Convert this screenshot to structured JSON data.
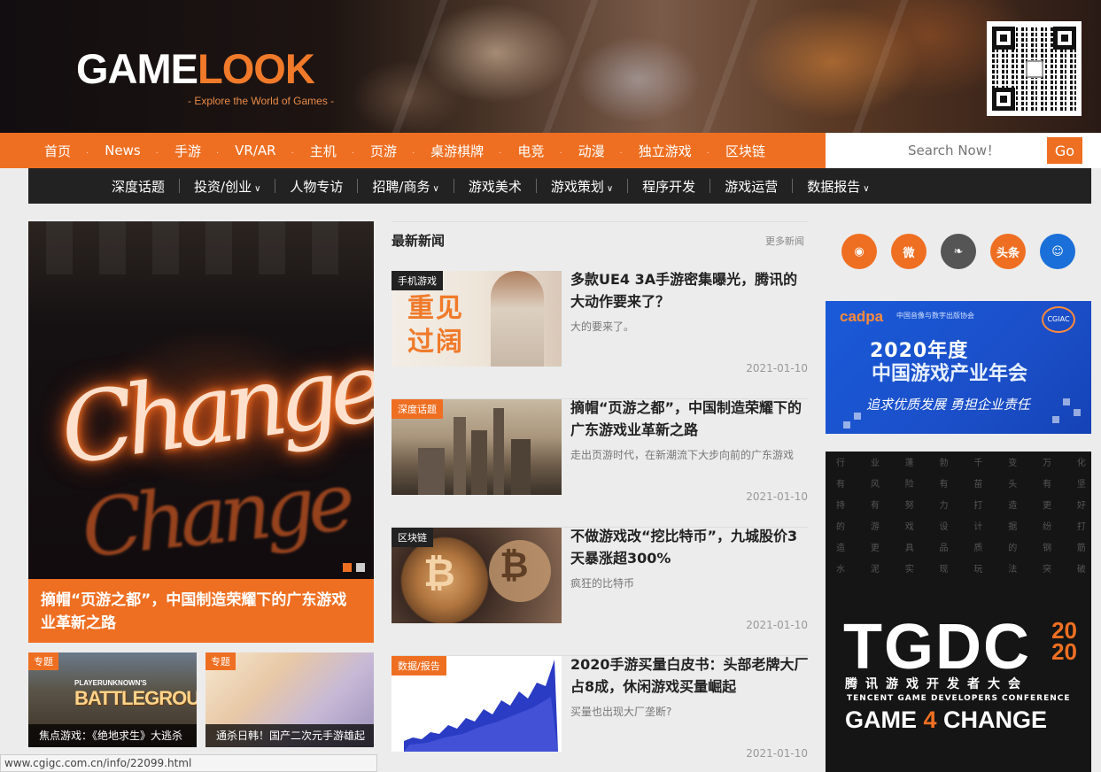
{
  "header": {
    "logo_game": "GAME",
    "logo_look": "LOOK",
    "tagline": "- Explore the World of Games -"
  },
  "nav_primary": [
    "首页",
    "News",
    "手游",
    "VR/AR",
    "主机",
    "页游",
    "桌游棋牌",
    "电竞",
    "动漫",
    "独立游戏",
    "区块链"
  ],
  "search": {
    "placeholder": "Search Now！",
    "button": "Go"
  },
  "nav_secondary": [
    {
      "label": "深度话题",
      "dropdown": false
    },
    {
      "label": "投资/创业",
      "dropdown": true
    },
    {
      "label": "人物专访",
      "dropdown": false
    },
    {
      "label": "招聘/商务",
      "dropdown": true
    },
    {
      "label": "游戏美术",
      "dropdown": false
    },
    {
      "label": "游戏策划",
      "dropdown": true
    },
    {
      "label": "程序开发",
      "dropdown": false
    },
    {
      "label": "游戏运营",
      "dropdown": false
    },
    {
      "label": "数据报告",
      "dropdown": true
    }
  ],
  "hero": {
    "neon_text": "Change",
    "caption": "摘帽“页游之都”，中国制造荣耀下的广东游戏业革新之路",
    "slides": 2,
    "active_slide": 1
  },
  "thumbs": [
    {
      "tag": "专题",
      "caption": "焦点游戏：《绝地求生》大逃杀",
      "art_small": "PLAYERUNKNOWN'S",
      "art_big": "BATTLEGROUNDS"
    },
    {
      "tag": "专题",
      "caption": "通杀日韩！国产二次元手游雄起"
    }
  ],
  "latest": {
    "heading": "最新新闻",
    "more": "更多新闻",
    "items": [
      {
        "tag": "手机游戏",
        "tag_color": "#222222",
        "title": "多款UE4 3A手游密集曝光，腾讯的大动作要来了？",
        "summary": "大的要来了。",
        "date": "2021-01-10",
        "img_text": "重见过阔"
      },
      {
        "tag": "深度话题",
        "tag_color": "#ef6f22",
        "title": "摘帽“页游之都”，中国制造荣耀下的广东游戏业革新之路",
        "summary": "走出页游时代，在新潮流下大步向前的广东游戏",
        "date": "2021-01-10"
      },
      {
        "tag": "区块链",
        "tag_color": "#222222",
        "title": "不做游戏改“挖比特币”，九城股价3天暴涨超300%",
        "summary": "疯狂的比特币",
        "date": "2021-01-10"
      },
      {
        "tag": "数据/报告",
        "tag_color": "#ef6f22",
        "title": "2020手游买量白皮书：头部老牌大厂占8成，休闲游戏买量崛起",
        "summary": "买量也出现大厂垄断?",
        "date": "2021-01-10"
      }
    ]
  },
  "social": [
    {
      "name": "rss-icon",
      "label": "◉",
      "color": "#ef6f22"
    },
    {
      "name": "weibo-icon",
      "label": "微",
      "color": "#ef6f22"
    },
    {
      "name": "wechat-icon",
      "label": "❧",
      "color": "#555555"
    },
    {
      "name": "toutiao-icon",
      "label": "头条",
      "color": "#ef6f22"
    },
    {
      "name": "qq-icon",
      "label": "☺",
      "color": "#1a6fd8"
    }
  ],
  "ad_cadpa": {
    "brand": "cadpa",
    "assoc": "中国音像与数字出版协会",
    "badge": "CGIAC",
    "year": "2020年度",
    "title": "中国游戏产业年会",
    "slogan": "追求优质发展  勇担企业责任"
  },
  "ad_tgdc": {
    "grid_chars": [
      "行业蓬勃千变万化",
      "有风险有苗头有坚",
      "持有努力打造更好",
      "的游戏设计据纷打",
      "造更具品质的钢筋",
      "水泥实现玩法突破"
    ],
    "logo": "TGDC",
    "year_top": "20",
    "year_bottom": "20",
    "cn": "腾讯游戏开发者大会",
    "en": "TENCENT GAME DEVELOPERS CONFERENCE",
    "slogan_a": "GAME ",
    "slogan_4": "4",
    "slogan_b": " CHANGE"
  },
  "statusbar": "www.cgigc.com.cn/info/22099.html"
}
